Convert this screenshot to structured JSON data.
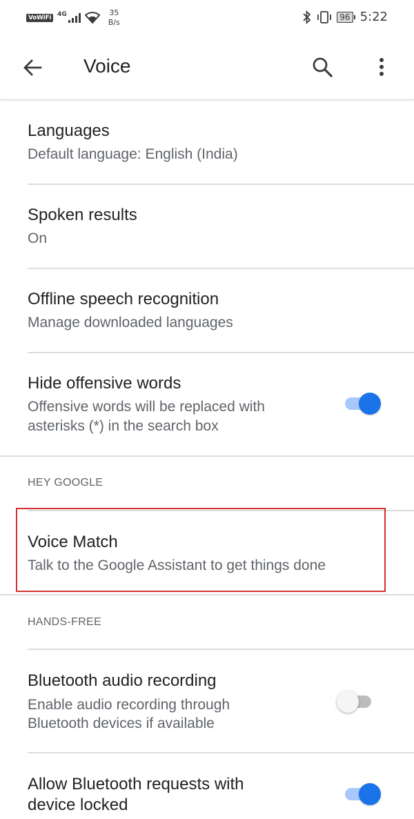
{
  "status_bar": {
    "vowifi": "VoWiFi",
    "network": "4G",
    "speed_value": "35",
    "speed_unit": "B/s",
    "battery": "96",
    "time": "5:22"
  },
  "app_bar": {
    "title": "Voice",
    "back_icon": "arrow-back-icon",
    "search_icon": "search-icon",
    "more_icon": "more-vert-icon"
  },
  "settings": {
    "languages": {
      "title": "Languages",
      "subtitle": "Default language: English (India)"
    },
    "spoken_results": {
      "title": "Spoken results",
      "subtitle": "On"
    },
    "offline": {
      "title": "Offline speech recognition",
      "subtitle": "Manage downloaded languages"
    },
    "offensive": {
      "title": "Hide offensive words",
      "subtitle_line1": "Offensive words will be replaced with",
      "subtitle_line2": "asterisks (*) in the search box",
      "enabled": true
    },
    "hey_google_header": "HEY GOOGLE",
    "voice_match": {
      "title": "Voice Match",
      "subtitle": "Talk to the Google Assistant to get things done"
    },
    "hands_free_header": "HANDS-FREE",
    "bt_audio": {
      "title": "Bluetooth audio recording",
      "subtitle_line1": "Enable audio recording through",
      "subtitle_line2": "Bluetooth devices if available",
      "enabled": false
    },
    "bt_requests": {
      "title_line1": "Allow Bluetooth requests with",
      "title_line2": "device locked",
      "enabled": true
    }
  },
  "colors": {
    "accent": "#1a73e8",
    "accent_track": "#a8c7fa",
    "highlight_border": "#d32f2f"
  }
}
